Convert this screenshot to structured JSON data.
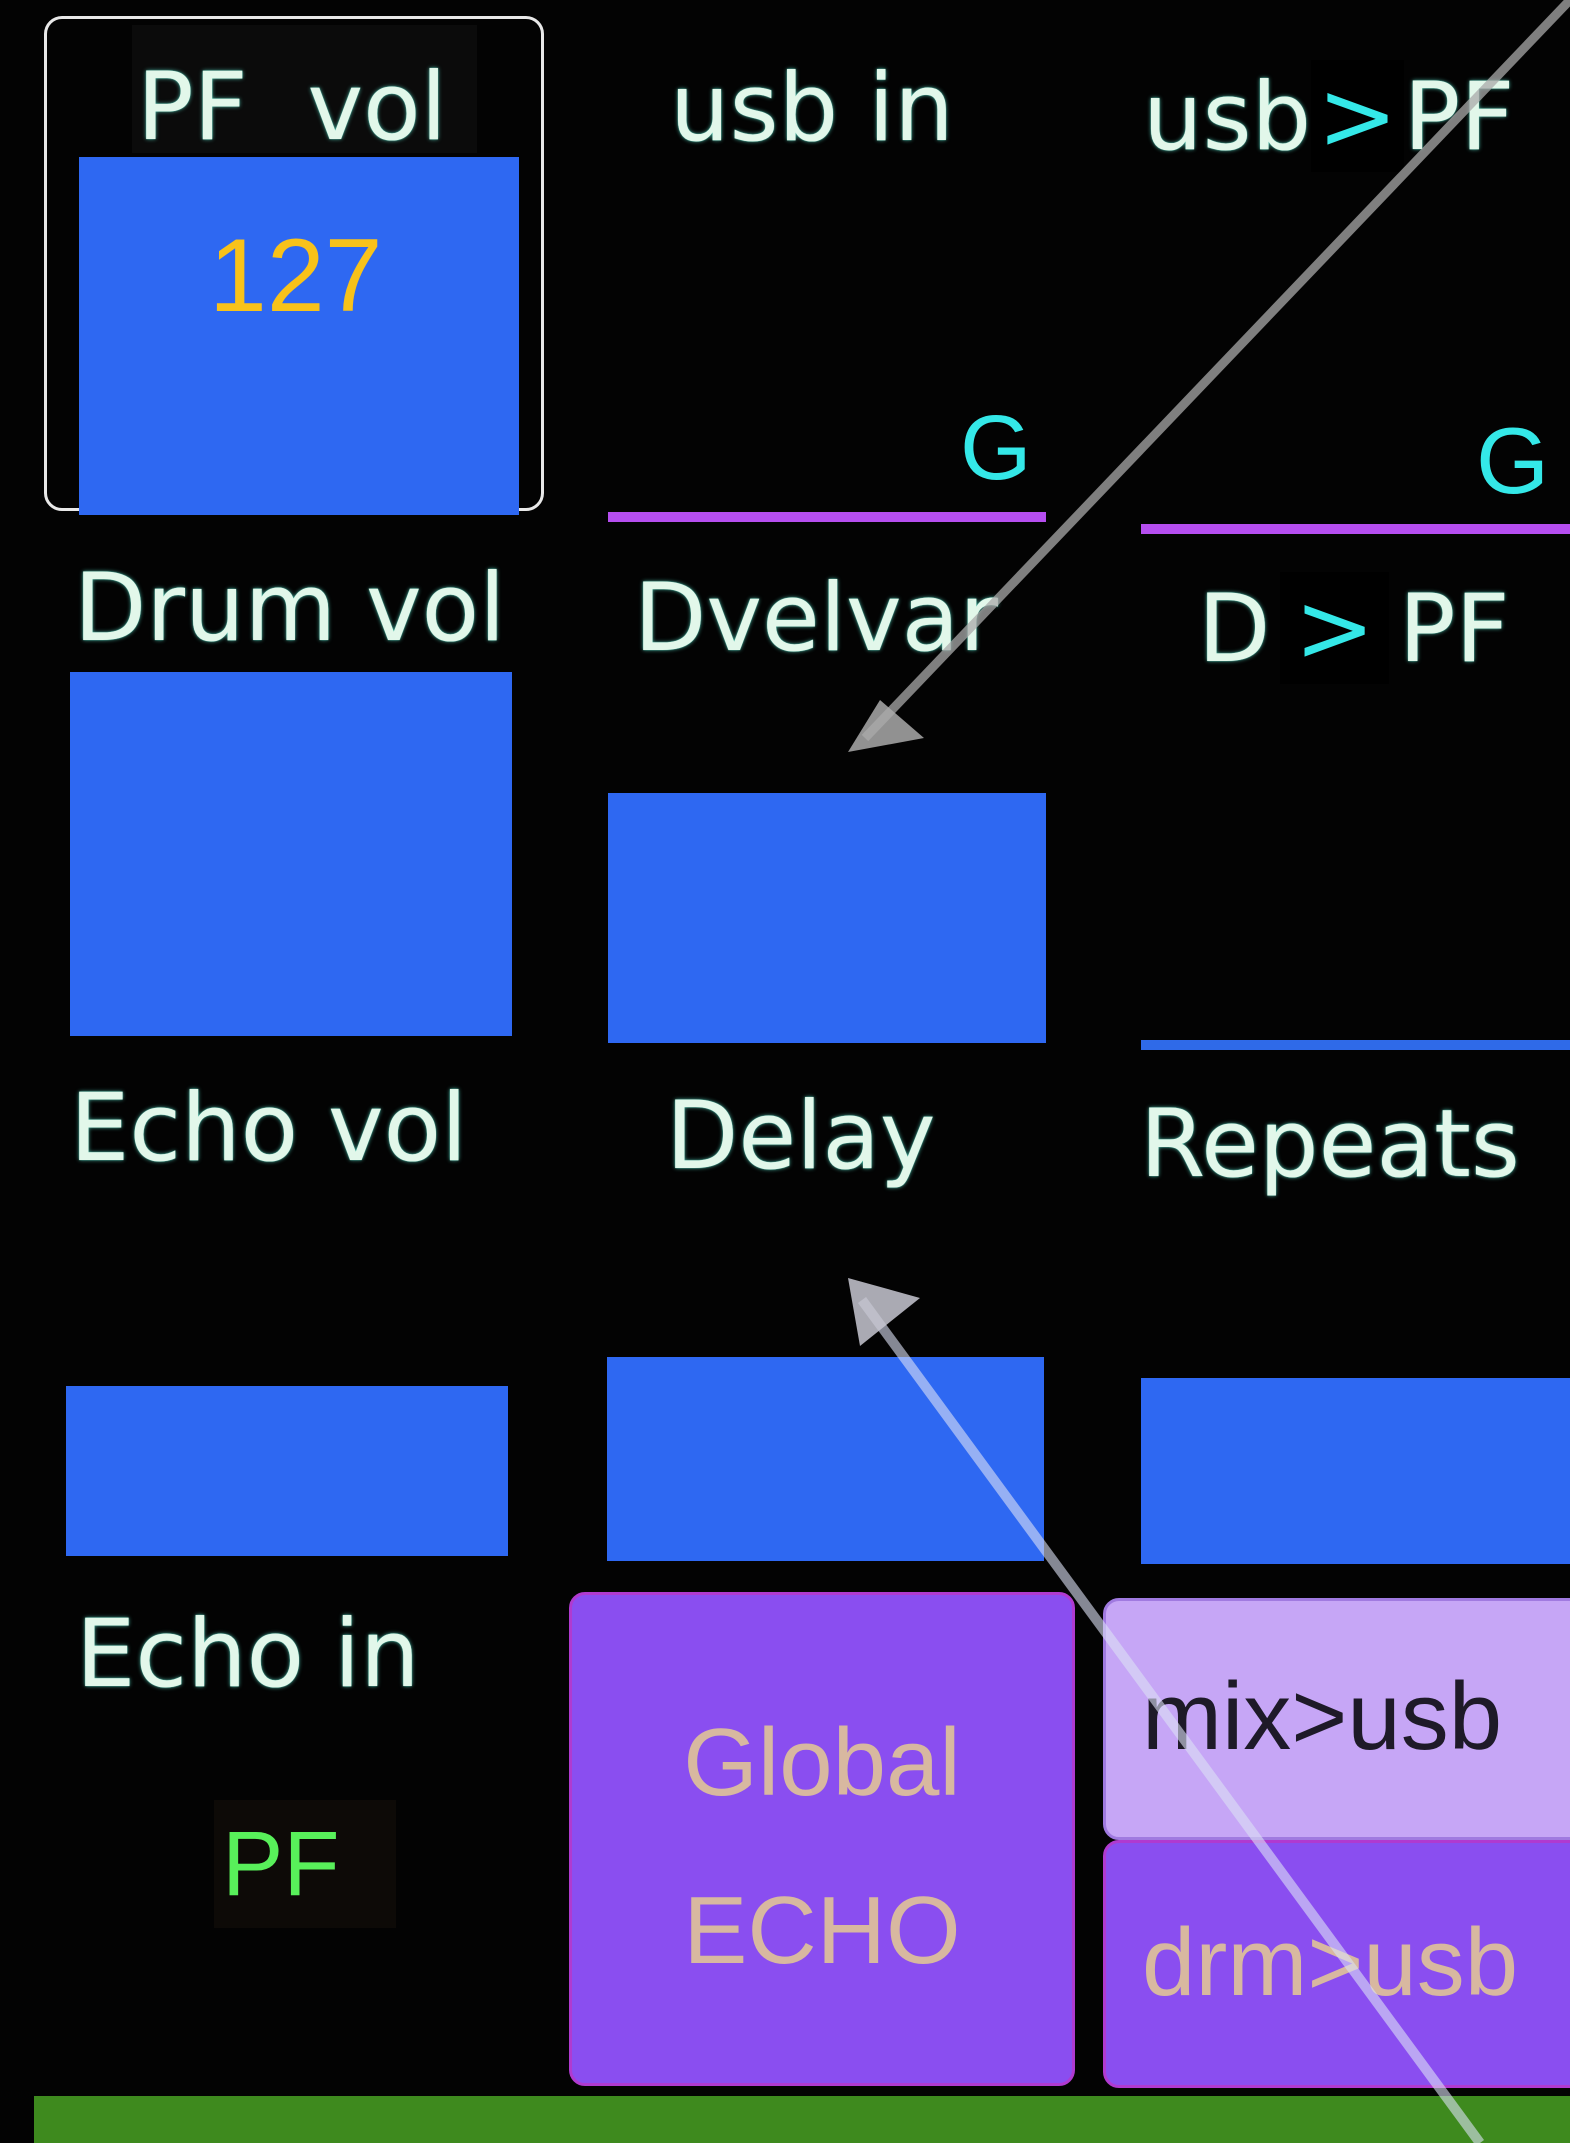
{
  "controls": {
    "pf_vol": {
      "label": "PF  vol",
      "value": "127"
    },
    "usb_in": {
      "label": "usb in",
      "g": "G"
    },
    "usb_pf": {
      "label_a": "usb",
      "arrow": ">",
      "label_b": "PF",
      "g": "G"
    },
    "drum_vol": {
      "label": "Drum vol"
    },
    "dvelvar": {
      "label": "Dvelvar"
    },
    "d_pf": {
      "label_a": "D",
      "arrow": ">",
      "label_b": "PF"
    },
    "echo_vol": {
      "label": "Echo vol"
    },
    "delay": {
      "label": "Delay"
    },
    "repeats": {
      "label": "Repeats"
    },
    "echo_in": {
      "label": "Echo in",
      "value": "PF"
    }
  },
  "buttons": {
    "global_echo": {
      "line1": "Global",
      "line2": "ECHO"
    },
    "mix_usb": {
      "label": "mix>usb"
    },
    "drm_usb": {
      "label": "drm>usb"
    }
  },
  "colors": {
    "background": "#030303",
    "slider_fill": "#2e68f2",
    "label_text": "#e2f7ea",
    "value_yellow": "#f8c21a",
    "cyan": "#34e8e8",
    "magenta_line": "#b64ef0",
    "button_purple": "#8a4ef0",
    "button_light": "#c6a6f6",
    "green_bar": "#3e8a1e"
  }
}
